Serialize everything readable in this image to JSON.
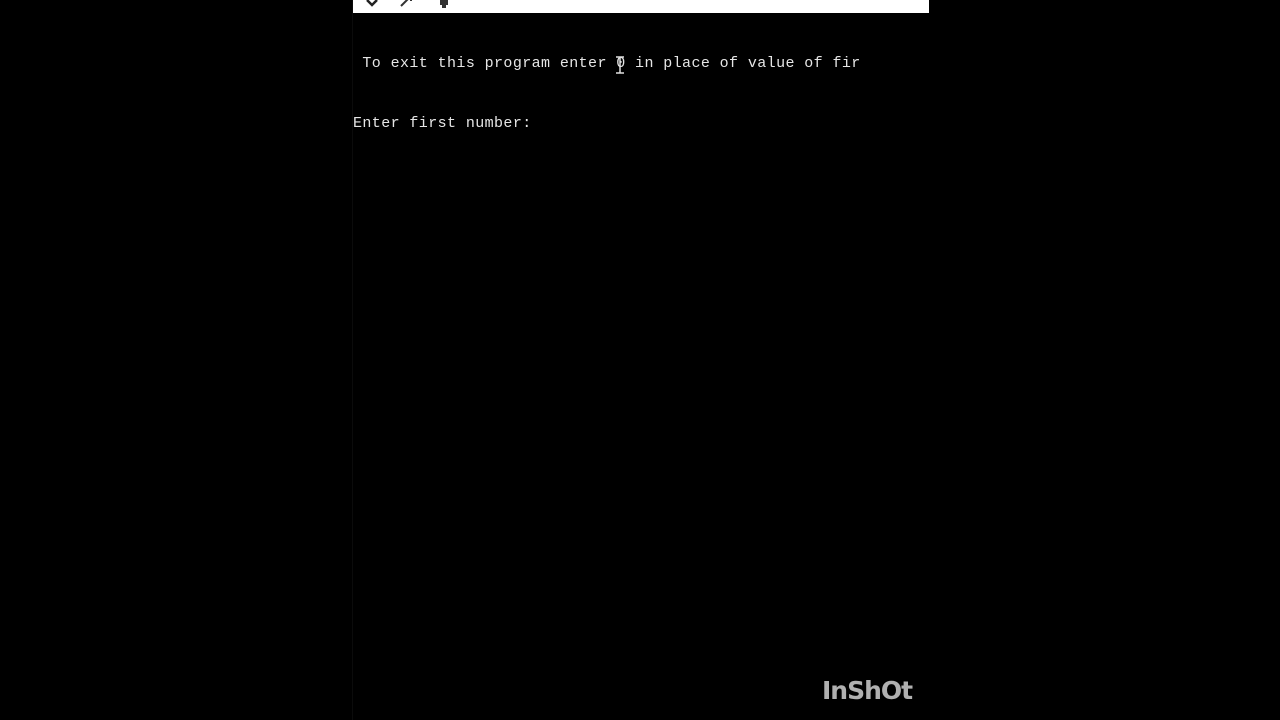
{
  "console": {
    "lines": [
      " To exit this program enter 0 in place of value of fir",
      "Enter first number:"
    ]
  },
  "titlebar": {
    "icons": [
      "chevron-down-icon",
      "resize-icon",
      "pin-icon"
    ]
  },
  "watermark": {
    "text": "InShOt"
  }
}
